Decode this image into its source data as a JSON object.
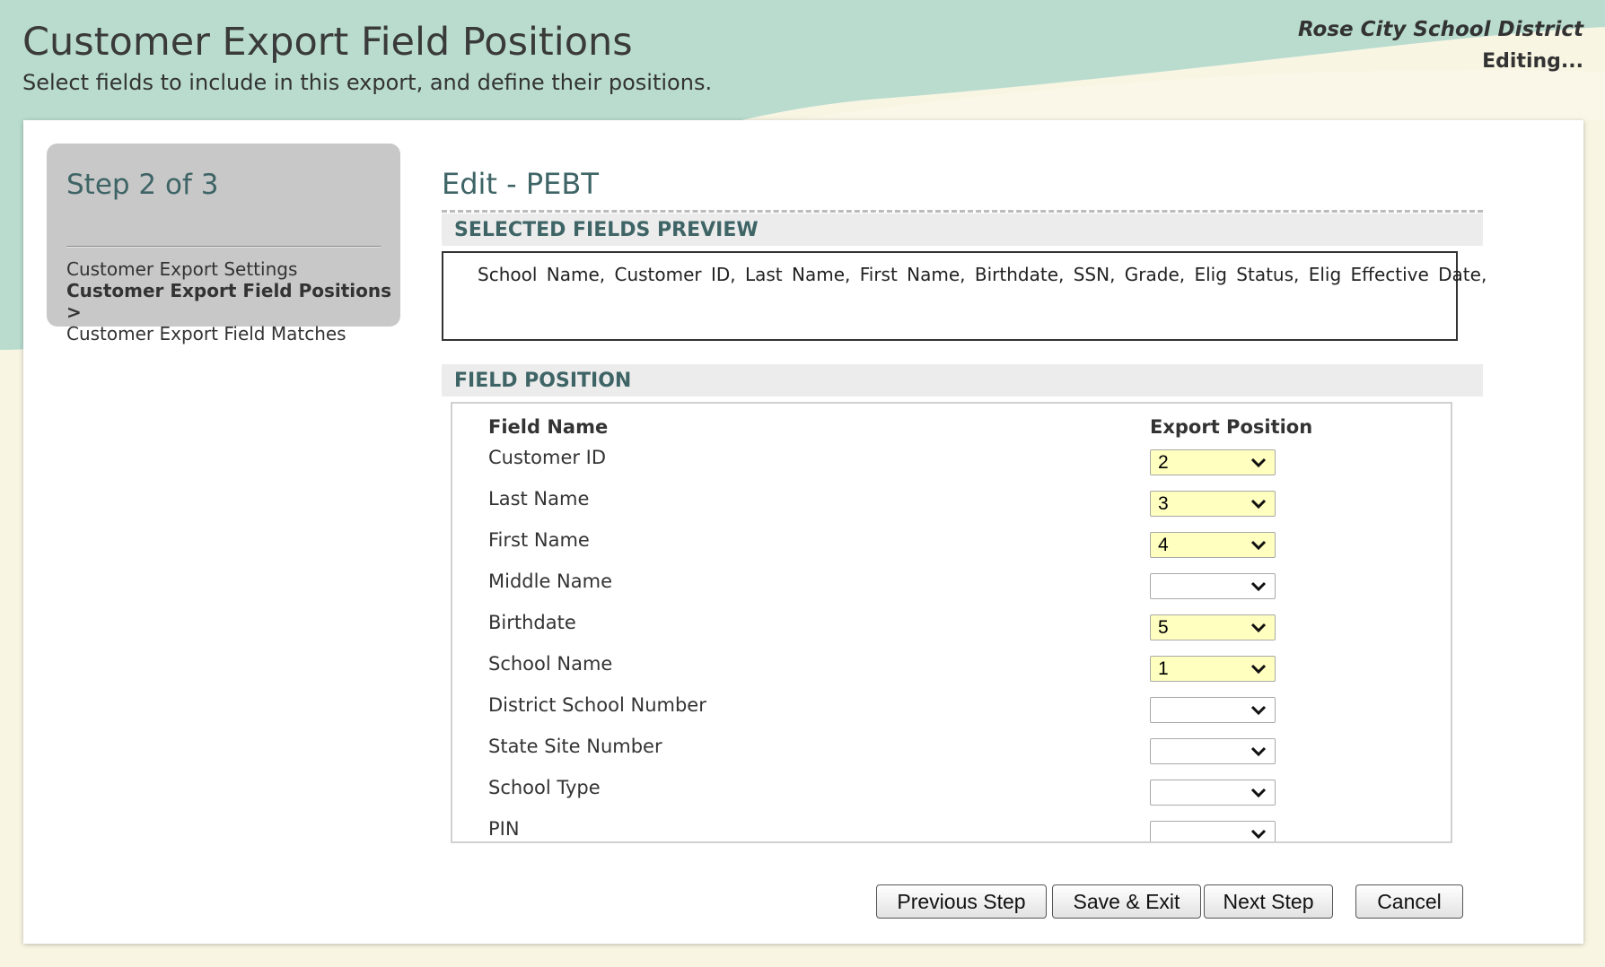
{
  "header": {
    "title": "Customer Export Field Positions",
    "subtitle": "Select fields to include in this export, and define their positions.",
    "district": "Rose City School District",
    "status": "Editing..."
  },
  "steps": {
    "title": "Step 2 of 3",
    "items": [
      {
        "label": "Customer Export Settings"
      },
      {
        "label": "Customer Export Field Positions >"
      },
      {
        "label": "Customer Export Field Matches"
      }
    ]
  },
  "main": {
    "edit_title": "Edit - PEBT",
    "preview_heading": "SELECTED FIELDS PREVIEW",
    "preview_text": "School Name,  Customer ID,  Last Name,  First Name,  Birthdate,  SSN,  Grade,  Elig Status,  Elig Effective Date,",
    "position_heading": "FIELD POSITION",
    "columns": {
      "field_name": "Field Name",
      "export_position": "Export Position"
    },
    "rows": [
      {
        "name": "Customer ID",
        "position": "2"
      },
      {
        "name": "Last Name",
        "position": "3"
      },
      {
        "name": "First Name",
        "position": "4"
      },
      {
        "name": "Middle Name",
        "position": ""
      },
      {
        "name": "Birthdate",
        "position": "5"
      },
      {
        "name": "School Name",
        "position": "1"
      },
      {
        "name": "District School Number",
        "position": ""
      },
      {
        "name": "State Site Number",
        "position": ""
      },
      {
        "name": "School Type",
        "position": ""
      },
      {
        "name": "PIN",
        "position": ""
      }
    ]
  },
  "buttons": {
    "previous": "Previous Step",
    "save_exit": "Save & Exit",
    "next": "Next Step",
    "cancel": "Cancel"
  },
  "colors": {
    "header_teal": "#b9dccf",
    "background_cream": "#f8f5e3",
    "heading_teal": "#3e6466",
    "selected_fill": "#ffffc0"
  },
  "icons": {
    "select_arrow": "chevron-down-icon"
  }
}
